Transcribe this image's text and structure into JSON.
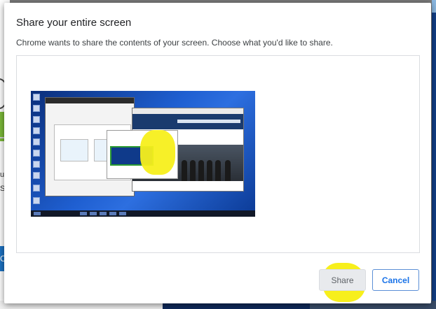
{
  "background": {
    "partial_text_1": "u",
    "partial_text_2": "S",
    "partial_button": "C"
  },
  "dialog": {
    "title": "Share your entire screen",
    "subtitle": "Chrome wants to share the contents of your screen. Choose what you'd like to share.",
    "screen_thumbnail_icon": "screen-preview-icon",
    "buttons": {
      "share_label": "Share",
      "cancel_label": "Cancel"
    },
    "share_enabled": false
  },
  "colors": {
    "accent": "#1a73e8",
    "highlight": "#f7ef1c",
    "disabled_button": "#e8eaed"
  }
}
